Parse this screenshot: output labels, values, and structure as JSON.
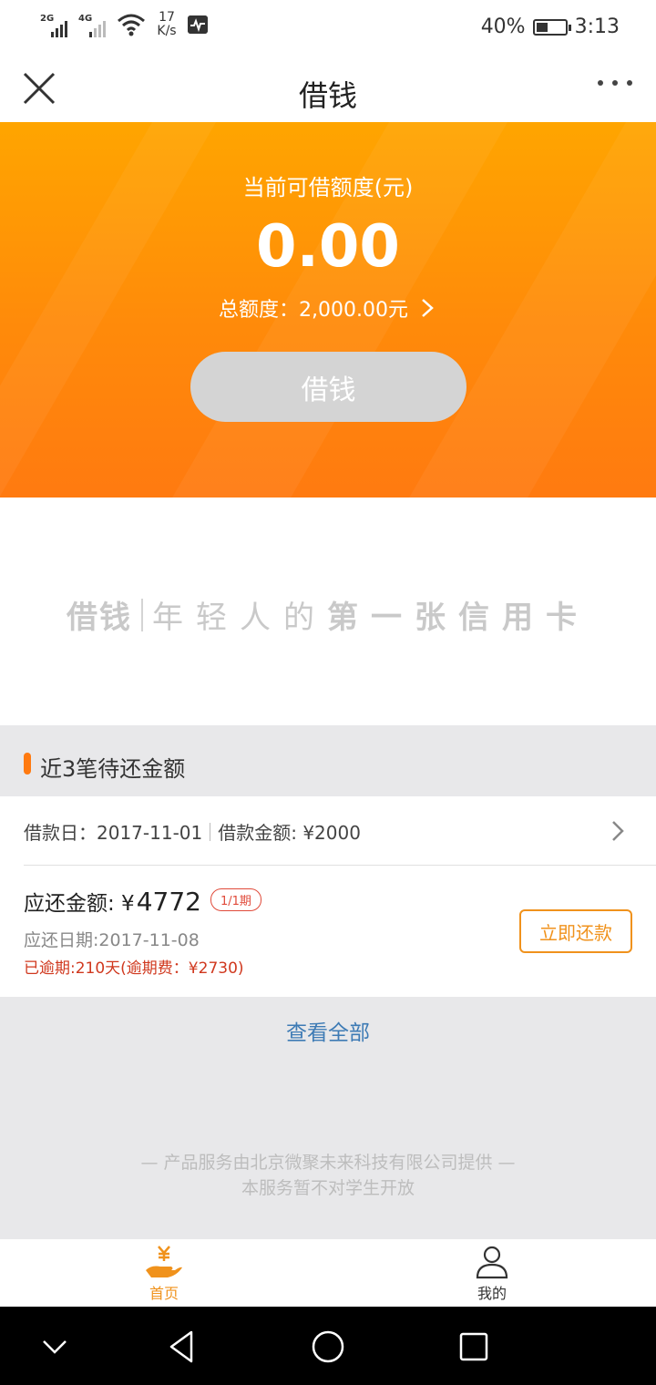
{
  "status_bar": {
    "net1": "2G",
    "net2": "4G",
    "speed_value": "17",
    "speed_unit": "K/s",
    "battery": "40%",
    "time": "3:13"
  },
  "nav": {
    "title": "借钱"
  },
  "hero": {
    "label": "当前可借额度(元)",
    "amount": "0.00",
    "total": "总额度：2,000.00元",
    "borrow_button": "借钱",
    "borrow_button_color": "#d4d4d4",
    "gradient_top": "#ffa500",
    "gradient_bottom": "#ff7a10"
  },
  "banner": {
    "brand": "借钱",
    "slogan_light": "年轻人的",
    "slogan_bold": "第一张信用卡"
  },
  "section": {
    "title": "近3笔待还金额",
    "accent": "#ff7a10"
  },
  "loan": {
    "borrow_date": "借款日：2017-11-01",
    "borrow_amount": "借款金额: ¥2000",
    "due_label": "应还金额: ¥",
    "due_amount": "4772",
    "period": "1/1期",
    "due_date": "应还日期:2017-11-08",
    "overdue": "已逾期:210天(逾期费：¥2730)",
    "repay_button": "立即还款"
  },
  "view_all": "查看全部",
  "footer": {
    "line1": "— 产品服务由北京微聚未来科技有限公司提供 —",
    "line2": "本服务暂不对学生开放"
  },
  "tabs": {
    "home": "首页",
    "mine": "我的",
    "home_icon": "yuan-hand-icon",
    "mine_icon": "person-icon"
  }
}
